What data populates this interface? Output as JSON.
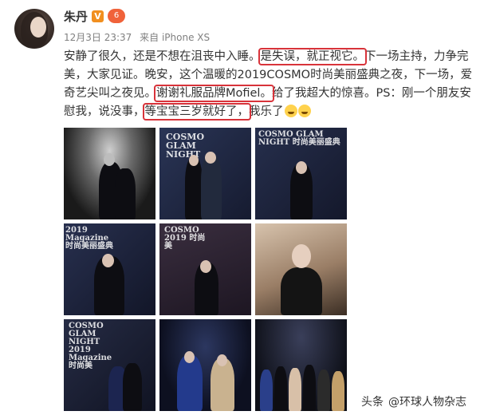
{
  "user": {
    "name": "朱丹",
    "vip_badge": "V",
    "level_badge": "6"
  },
  "meta": {
    "time": "12月3日 23:37",
    "source": "来自 iPhone XS"
  },
  "post": {
    "seg1": "安静了很久，还是不想在沮丧中入睡。",
    "hl1": "是失误，就正视它。",
    "seg2": "下一场主持，力争完美，大家见证。晚安，这个温暖的2019COSMO时尚美丽盛典之夜，下一场，爱奇艺尖叫之夜见。",
    "hl2": "谢谢礼服品牌Mofiel。",
    "seg3": "给了我超大的惊喜。PS：刚一个朋友安慰我，说没事，",
    "hl3": "等宝宝三岁就好了，",
    "seg4": "我乐了"
  },
  "photos": [
    {
      "label": "",
      "tone": "bw"
    },
    {
      "label": "COSMO GLAM NIGHT",
      "tone": "navy"
    },
    {
      "label": "COSMO GLAM NIGHT 时尚美丽盛典",
      "tone": "navy"
    },
    {
      "label": "2019 Magazine 时尚美丽盛典",
      "tone": "navy"
    },
    {
      "label": "COSMO 2019 时尚美",
      "tone": "navy"
    },
    {
      "label": "",
      "tone": "warm"
    },
    {
      "label": "COSMO GLAM NIGHT 2019 Magazine 时尚美",
      "tone": "navy"
    },
    {
      "label": "",
      "tone": "dark"
    },
    {
      "label": "",
      "tone": "dark"
    }
  ],
  "watermark": {
    "prefix": "头条",
    "site": "@环球人物杂志"
  },
  "colors": {
    "highlight_border": "#d8333a",
    "meta_text": "#808080",
    "vip_badge": "#f18f1f"
  }
}
